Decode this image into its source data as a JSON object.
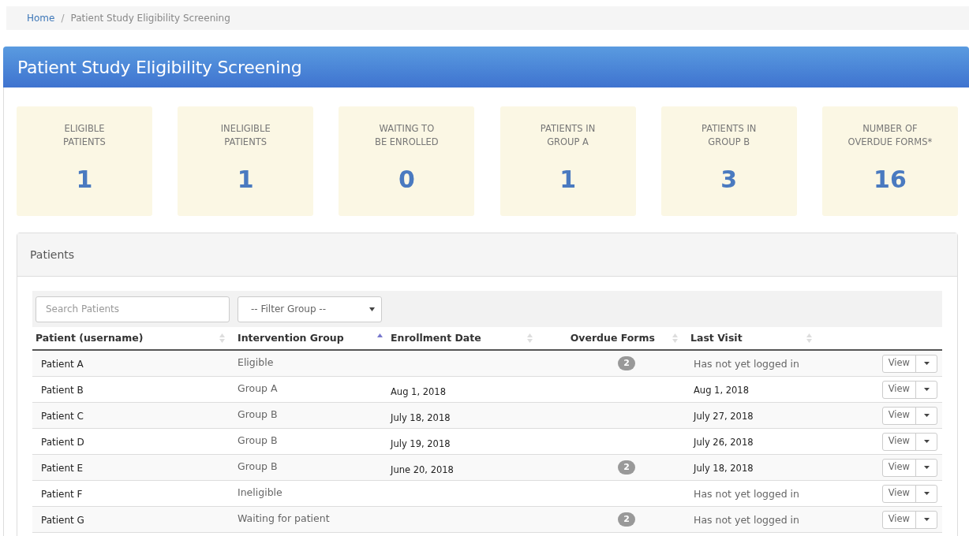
{
  "breadcrumb_separator": "/",
  "breadcrumb": [
    {
      "label": "Home",
      "kind": "link"
    },
    {
      "label": "Patient Study Eligibility Screening",
      "kind": "current"
    }
  ],
  "panel": {
    "title": "Patient Study Eligibility Screening"
  },
  "stats": [
    {
      "label": "ELIGIBLE\nPATIENTS",
      "value": "1"
    },
    {
      "label": "INELIGIBLE\nPATIENTS",
      "value": "1"
    },
    {
      "label": "WAITING TO\nBE ENROLLED",
      "value": "0"
    },
    {
      "label": "PATIENTS IN\nGROUP A",
      "value": "1"
    },
    {
      "label": "PATIENTS IN\nGROUP B",
      "value": "3"
    },
    {
      "label": "NUMBER OF\nOVERDUE FORMS*",
      "value": "16"
    }
  ],
  "patients": {
    "title": "Patients",
    "search": {
      "placeholder": "Search Patients"
    },
    "filter": {
      "value": "-- Filter Group --"
    },
    "columns": [
      {
        "label": "Patient (username)",
        "sorted": false
      },
      {
        "label": "Intervention Group",
        "sorted": true
      },
      {
        "label": "Enrollment Date",
        "sorted": false
      },
      {
        "label": "Overdue Forms",
        "sorted": false
      },
      {
        "label": "Last Visit",
        "sorted": false
      }
    ],
    "rows": [
      {
        "patient": "Patient A",
        "group": "Eligible",
        "overdue": "2",
        "last_visit": {
          "text": "Has not yet logged in",
          "kind": "note"
        },
        "action": "View"
      },
      {
        "patient": "Patient B",
        "group": "Group A",
        "enrollment": "Aug 1, 2018",
        "last_visit": {
          "text": "Aug 1, 2018",
          "kind": "date"
        },
        "action": "View"
      },
      {
        "patient": "Patient C",
        "group": "Group B",
        "enrollment": "July 18, 2018",
        "last_visit": {
          "text": "July 27, 2018",
          "kind": "date"
        },
        "action": "View"
      },
      {
        "patient": "Patient D",
        "group": "Group B",
        "enrollment": "July 19, 2018",
        "last_visit": {
          "text": "July 26, 2018",
          "kind": "date"
        },
        "action": "View"
      },
      {
        "patient": "Patient E",
        "group": "Group B",
        "enrollment": "June 20, 2018",
        "overdue": "2",
        "last_visit": {
          "text": "July 18, 2018",
          "kind": "date"
        },
        "action": "View"
      },
      {
        "patient": "Patient F",
        "group": "Ineligible",
        "last_visit": {
          "text": "Has not yet logged in",
          "kind": "note"
        },
        "action": "View"
      },
      {
        "patient": "Patient G",
        "group": "Waiting for patient",
        "overdue": "2",
        "last_visit": {
          "text": "Has not yet logged in",
          "kind": "note"
        },
        "action": "View"
      }
    ]
  }
}
